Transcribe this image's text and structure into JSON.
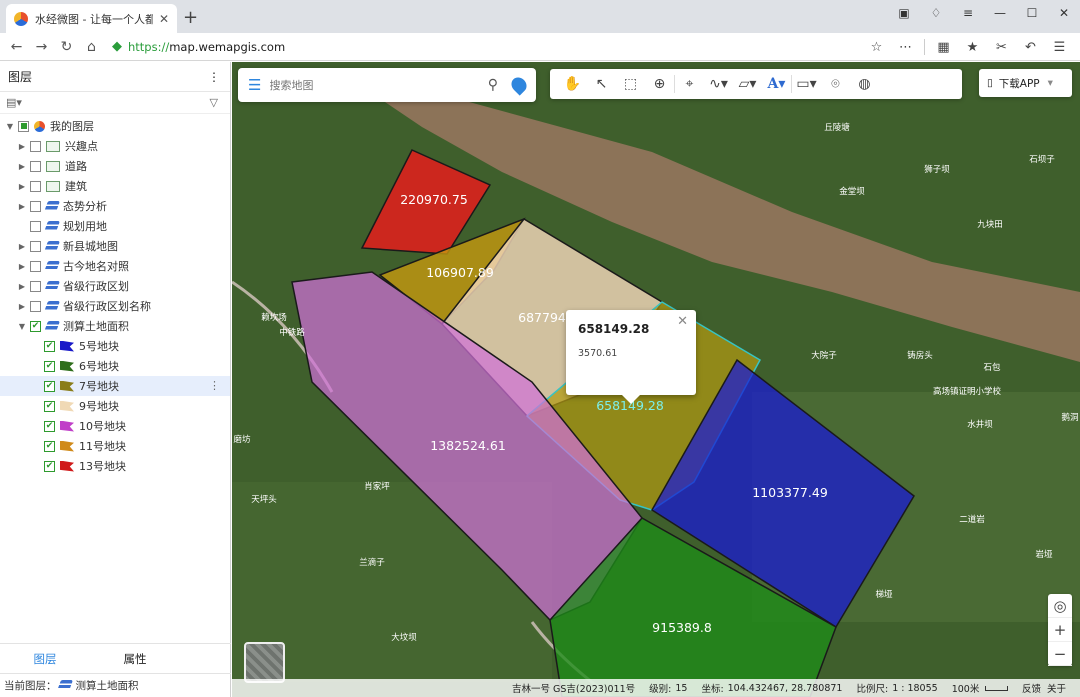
{
  "browser": {
    "tab_title": "水经微图 - 让每一个人都有自",
    "url_scheme": "https://",
    "url_rest": "map.wemapgis.com"
  },
  "sidebar": {
    "title": "图层",
    "tree_root": "我的图层",
    "items": [
      {
        "label": "兴趣点",
        "icon": "poi-icon"
      },
      {
        "label": "道路",
        "icon": "poi-icon"
      },
      {
        "label": "建筑",
        "icon": "poi-icon"
      },
      {
        "label": "态势分析",
        "icon": "layer-icon"
      },
      {
        "label": "规划用地",
        "icon": "layer-icon"
      },
      {
        "label": "新县城地图",
        "icon": "layer-icon"
      },
      {
        "label": "古今地名对照",
        "icon": "layer-icon"
      },
      {
        "label": "省级行政区划",
        "icon": "layer-icon"
      },
      {
        "label": "省级行政区划名称",
        "icon": "layer-icon"
      },
      {
        "label": "测算土地面积",
        "icon": "layer-icon"
      }
    ],
    "sub_items": [
      {
        "label": "5号地块",
        "color": "#1a1ac8"
      },
      {
        "label": "6号地块",
        "color": "#2f6e1c"
      },
      {
        "label": "7号地块",
        "color": "#8a7d1a"
      },
      {
        "label": "9号地块",
        "color": "#f0d9b5"
      },
      {
        "label": "10号地块",
        "color": "#c040c8"
      },
      {
        "label": "11号地块",
        "color": "#d08a1a"
      },
      {
        "label": "13号地块",
        "color": "#d01a1a"
      }
    ],
    "tab_layers": "图层",
    "tab_attrs": "属性",
    "status_prefix": "当前图层",
    "status_layer": "测算土地面积"
  },
  "map": {
    "search_placeholder": "搜索地图",
    "download_label": "下载APP",
    "popup_title": "658149.28",
    "popup_value": "3570.61",
    "parcel_labels": [
      "220970.75",
      "106907.89",
      "687794",
      "658149.28",
      "1382524.61",
      "1103377.49",
      "915389.8"
    ],
    "place_labels": [
      "丘陵塘",
      "石坝子",
      "狮子坝",
      "九块田",
      "金堂坝",
      "大院子",
      "铸房头",
      "石包",
      "高场镇证明小学校",
      "鹅洞",
      "水井坝",
      "磨坊",
      "肖家坪",
      "天坪头",
      "兰滴子",
      "大坟坝",
      "岩垭",
      "梯垭",
      "中铁路",
      "二道岩",
      "赖坎场"
    ],
    "status": {
      "source": "吉林一号 GS吉(2023)011号",
      "level_label": "级别:",
      "level": "15",
      "coord_label": "坐标:",
      "coord": "104.432467, 28.780871",
      "scale_label": "比例尺:",
      "scale": "1 : 18055",
      "scale_unit": "100米",
      "feedback": "反馈",
      "about": "关于"
    }
  }
}
